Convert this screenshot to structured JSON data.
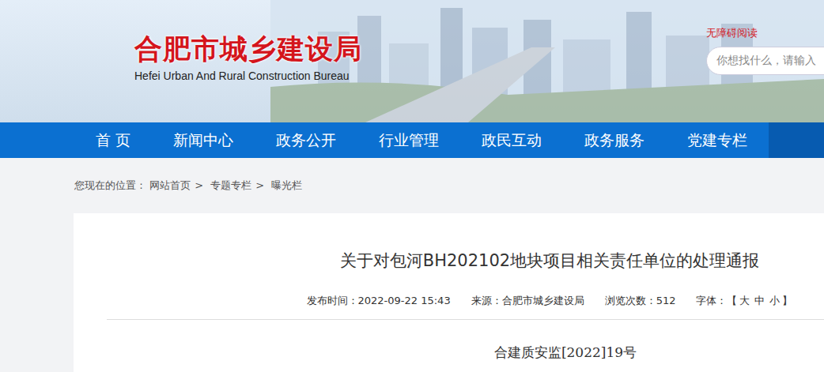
{
  "header": {
    "logo_title": "合肥市城乡建设局",
    "logo_subtitle": "Hefei Urban And Rural Construction Bureau",
    "accessibility_link": "无障碍阅读",
    "search": {
      "placeholder": "你想找什么，请输入"
    }
  },
  "nav": [
    {
      "label": "首 页",
      "selected": false
    },
    {
      "label": "新闻中心",
      "selected": false
    },
    {
      "label": "政务公开",
      "selected": false
    },
    {
      "label": "行业管理",
      "selected": false
    },
    {
      "label": "政民互动",
      "selected": false
    },
    {
      "label": "政务服务",
      "selected": false
    },
    {
      "label": "党建专栏",
      "selected": false
    }
  ],
  "breadcrumb": {
    "prefix": "您现在的位置：",
    "separator": ">",
    "items": [
      "网站首页",
      "专题专栏",
      "曝光栏"
    ]
  },
  "article": {
    "title": "关于对包河BH202102地块项目相关责任单位的处理通报",
    "published": "发布时间：2022-09-22 15:43",
    "source": "来源：合肥市城乡建设局",
    "views": "浏览次数：512",
    "font_label": "字体：【",
    "font_sizes": [
      "大",
      "中",
      "小"
    ],
    "font_close": "】",
    "doc_number": "合建质安监[2022]19号"
  }
}
